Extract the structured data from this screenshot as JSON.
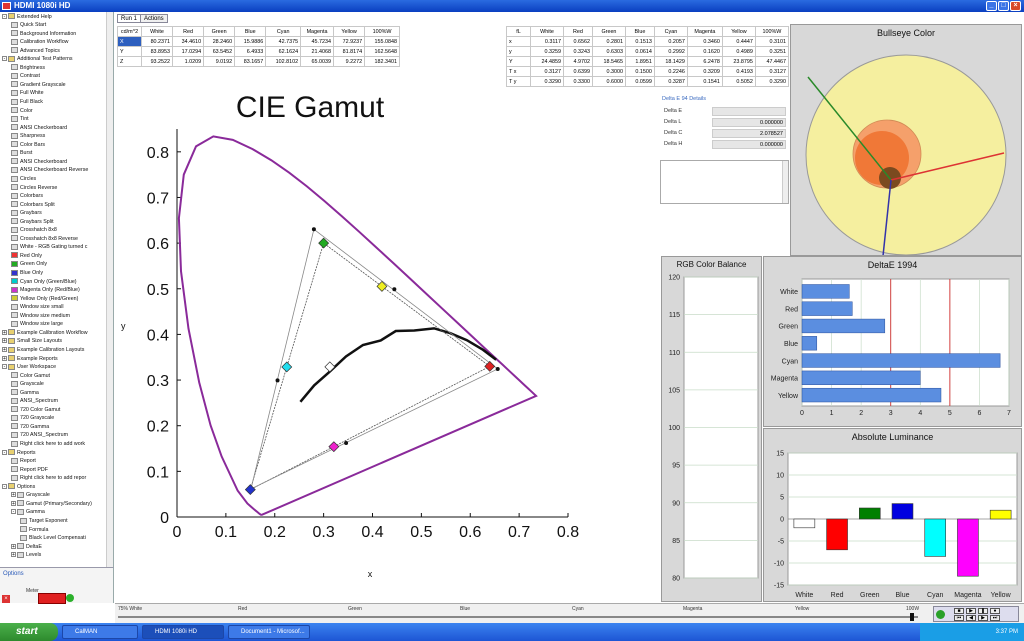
{
  "window": {
    "title": "HDMI 1080i HD"
  },
  "tabs": [
    "Run 1",
    "Actions"
  ],
  "sidebar": {
    "items": [
      {
        "label": "Extended Help",
        "level": 0,
        "pm": "-"
      },
      {
        "label": "Quick Start",
        "level": 1
      },
      {
        "label": "Background Information",
        "level": 1
      },
      {
        "label": "Calibration Workflow",
        "level": 1
      },
      {
        "label": "Advanced Topics",
        "level": 1
      },
      {
        "label": "Additional Test Patterns",
        "level": 0,
        "pm": "-"
      },
      {
        "label": "Brightness",
        "level": 1
      },
      {
        "label": "Contrast",
        "level": 1
      },
      {
        "label": "Gradient Grayscale",
        "level": 1
      },
      {
        "label": "Full White",
        "level": 1
      },
      {
        "label": "Full Black",
        "level": 1
      },
      {
        "label": "Color",
        "level": 1
      },
      {
        "label": "Tint",
        "level": 1
      },
      {
        "label": "ANSI Checkerboard",
        "level": 1
      },
      {
        "label": "Sharpness",
        "level": 1
      },
      {
        "label": "Color Bars",
        "level": 1
      },
      {
        "label": "Burst",
        "level": 1
      },
      {
        "label": "ANSI Checkerboard",
        "level": 1
      },
      {
        "label": "ANSI Checkerboard Reverse",
        "level": 1
      },
      {
        "label": "Circles",
        "level": 1
      },
      {
        "label": "Circles Reverse",
        "level": 1
      },
      {
        "label": "Colorbars",
        "level": 1
      },
      {
        "label": "Colorbars Split",
        "level": 1
      },
      {
        "label": "Graybars",
        "level": 1
      },
      {
        "label": "Graybars Split",
        "level": 1
      },
      {
        "label": "Crosshatch 8x8",
        "level": 1
      },
      {
        "label": "Crosshatch 8x8 Reverse",
        "level": 1
      },
      {
        "label": "White - RGB Gating turned c",
        "level": 1
      },
      {
        "label": "Red Only",
        "level": 1
      },
      {
        "label": "Green Only",
        "level": 1
      },
      {
        "label": "Blue Only",
        "level": 1
      },
      {
        "label": "Cyan Only (Green/Blue)",
        "level": 1
      },
      {
        "label": "Magenta Only (Red/Blue)",
        "level": 1
      },
      {
        "label": "Yellow Only (Red/Green)",
        "level": 1
      },
      {
        "label": "Window size small",
        "level": 1
      },
      {
        "label": "Window size medium",
        "level": 1
      },
      {
        "label": "Window size large",
        "level": 1
      },
      {
        "label": "Example Calibration Workflow",
        "level": 0,
        "pm": "+"
      },
      {
        "label": "Small Size Layouts",
        "level": 0,
        "pm": "+"
      },
      {
        "label": "Example Calibration Layouts",
        "level": 0,
        "pm": "+"
      },
      {
        "label": "Example Reports",
        "level": 0,
        "pm": "+"
      },
      {
        "label": "User Workspace",
        "level": 0,
        "pm": "-"
      },
      {
        "label": "Color Gamut",
        "level": 1
      },
      {
        "label": "Grayscale",
        "level": 1
      },
      {
        "label": "Gamma",
        "level": 1
      },
      {
        "label": "ANSI_Spectrum",
        "level": 1
      },
      {
        "label": "720 Color Gamut",
        "level": 1
      },
      {
        "label": "720 Grayscale",
        "level": 1
      },
      {
        "label": "720 Gamma",
        "level": 1
      },
      {
        "label": "720 ANSI_Spectrum",
        "level": 1
      },
      {
        "label": "Right click here to add work",
        "level": 1
      },
      {
        "label": "Reports",
        "level": 0,
        "pm": "-"
      },
      {
        "label": "Report",
        "level": 1
      },
      {
        "label": "Report PDF",
        "level": 1
      },
      {
        "label": "Right click here to add repor",
        "level": 1
      },
      {
        "label": "Options",
        "level": 0,
        "pm": "-"
      },
      {
        "label": "Grayscale",
        "level": 1,
        "pm": "+"
      },
      {
        "label": "Gamut (Primary/Secondary)",
        "level": 1,
        "pm": "+"
      },
      {
        "label": "Gamma",
        "level": 1,
        "pm": "-"
      },
      {
        "label": "Target Exponent",
        "level": 2
      },
      {
        "label": "Formula",
        "level": 2
      },
      {
        "label": "Black Level Compensati",
        "level": 2
      },
      {
        "label": "DeltaE",
        "level": 1,
        "pm": "+"
      },
      {
        "label": "Levels",
        "level": 1,
        "pm": "+"
      }
    ],
    "options_label": "Options",
    "meter_label": "Meter"
  },
  "table1": {
    "headers": [
      "cd/m^2",
      "White",
      "Red",
      "Green",
      "Blue",
      "Cyan",
      "Magenta",
      "Yellow",
      "100%W"
    ],
    "rows": [
      [
        "X",
        "80.2371",
        "34.4610",
        "28.2460",
        "15.9886",
        "42.7375",
        "45.7234",
        "72.9237",
        "155.0848"
      ],
      [
        "Y",
        "83.8953",
        "17.0294",
        "63.5452",
        "6.4933",
        "62.1624",
        "21.4068",
        "81.8174",
        "162.5648"
      ],
      [
        "Z",
        "93.2522",
        "1.0209",
        "9.0192",
        "83.1657",
        "102.8102",
        "65.0039",
        "9.2272",
        "182.3401"
      ]
    ]
  },
  "table2": {
    "headers": [
      "fL",
      "White",
      "Red",
      "Green",
      "Blue",
      "Cyan",
      "Magenta",
      "Yellow",
      "100%W"
    ],
    "rows": [
      [
        "x",
        "0.3117",
        "0.6562",
        "0.2801",
        "0.1513",
        "0.2057",
        "0.3460",
        "0.4447",
        "0.3101"
      ],
      [
        "y",
        "0.3259",
        "0.3243",
        "0.6303",
        "0.0614",
        "0.2992",
        "0.1620",
        "0.4989",
        "0.3251"
      ],
      [
        "Y",
        "24.4859",
        "4.9702",
        "18.5465",
        "1.8951",
        "18.1429",
        "6.2478",
        "23.8795",
        "47.4467"
      ],
      [
        "T x",
        "0.3127",
        "0.6399",
        "0.3000",
        "0.1500",
        "0.2246",
        "0.3209",
        "0.4193",
        "0.3127"
      ],
      [
        "T y",
        "0.3290",
        "0.3300",
        "0.6000",
        "0.0599",
        "0.3287",
        "0.1541",
        "0.5052",
        "0.3290"
      ]
    ]
  },
  "delta_details": {
    "title": "Delta E 94 Details",
    "rows": [
      {
        "label": "Delta E",
        "value": ""
      },
      {
        "label": "Delta L",
        "value": "0.000000"
      },
      {
        "label": "Delta C",
        "value": "2.078527"
      },
      {
        "label": "Delta H",
        "value": "0.000000"
      }
    ]
  },
  "status_bar": {
    "labels": [
      "75% White",
      "Red",
      "Green",
      "Blue",
      "Cyan",
      "Magenta",
      "Yellow",
      "100W"
    ]
  },
  "taskbar": {
    "start": "start",
    "tasks": [
      "CalMAN",
      "HDMI 1080i HD",
      "Document1 - Microsof..."
    ],
    "clock": "3:37 PM"
  },
  "chart_data": [
    {
      "type": "scatter",
      "title": "CIE Gamut",
      "xlabel": "x",
      "ylabel": "y",
      "xlim": [
        0,
        0.8
      ],
      "ylim": [
        0,
        0.85
      ],
      "xticks": [
        "0",
        "0.1",
        "0.2",
        "0.3",
        "0.4",
        "0.5",
        "0.6",
        "0.7",
        "0.8"
      ],
      "yticks": [
        "0",
        "0.1",
        "0.2",
        "0.3",
        "0.4",
        "0.5",
        "0.6",
        "0.7",
        "0.8"
      ],
      "spectral_locus": [
        [
          0.1741,
          0.005
        ],
        [
          0.1738,
          0.0049
        ],
        [
          0.1733,
          0.0048
        ],
        [
          0.1726,
          0.0048
        ],
        [
          0.1714,
          0.0051
        ],
        [
          0.1689,
          0.0069
        ],
        [
          0.1644,
          0.0109
        ],
        [
          0.1566,
          0.0177
        ],
        [
          0.144,
          0.0297
        ],
        [
          0.1241,
          0.0578
        ],
        [
          0.0913,
          0.1327
        ],
        [
          0.0687,
          0.2007
        ],
        [
          0.0454,
          0.295
        ],
        [
          0.0235,
          0.4127
        ],
        [
          0.0082,
          0.5384
        ],
        [
          0.0039,
          0.6548
        ],
        [
          0.0139,
          0.7502
        ],
        [
          0.0389,
          0.812
        ],
        [
          0.0743,
          0.8338
        ],
        [
          0.1142,
          0.8262
        ],
        [
          0.1547,
          0.8059
        ],
        [
          0.1929,
          0.7816
        ],
        [
          0.2296,
          0.7543
        ],
        [
          0.2658,
          0.7243
        ],
        [
          0.3016,
          0.6923
        ],
        [
          0.3373,
          0.6589
        ],
        [
          0.3731,
          0.6245
        ],
        [
          0.4087,
          0.5896
        ],
        [
          0.4441,
          0.5547
        ],
        [
          0.4788,
          0.5202
        ],
        [
          0.5125,
          0.4866
        ],
        [
          0.5448,
          0.4544
        ],
        [
          0.5752,
          0.4242
        ],
        [
          0.6029,
          0.3965
        ],
        [
          0.627,
          0.3725
        ],
        [
          0.6482,
          0.3514
        ],
        [
          0.6658,
          0.334
        ],
        [
          0.6801,
          0.3197
        ],
        [
          0.6915,
          0.3083
        ],
        [
          0.7006,
          0.2993
        ],
        [
          0.7079,
          0.292
        ],
        [
          0.714,
          0.2859
        ],
        [
          0.719,
          0.2809
        ],
        [
          0.723,
          0.277
        ],
        [
          0.726,
          0.274
        ],
        [
          0.7347,
          0.2653
        ]
      ],
      "planckian_locus": [
        [
          0.2525,
          0.2523
        ],
        [
          0.2806,
          0.2883
        ],
        [
          0.3101,
          0.3162
        ],
        [
          0.3457,
          0.3516
        ],
        [
          0.3805,
          0.3768
        ],
        [
          0.4169,
          0.3868
        ],
        [
          0.4476,
          0.4074
        ],
        [
          0.4855,
          0.4087
        ],
        [
          0.526,
          0.4133
        ],
        [
          0.5586,
          0.4029
        ],
        [
          0.5932,
          0.3873
        ],
        [
          0.6262,
          0.3662
        ],
        [
          0.653,
          0.3446
        ]
      ],
      "target": {
        "x": [
          0.64,
          0.3,
          0.15
        ],
        "y": [
          0.33,
          0.6,
          0.06
        ]
      },
      "measured": {
        "x": [
          0.6562,
          0.2801,
          0.1513
        ],
        "y": [
          0.3243,
          0.6303,
          0.0614
        ]
      },
      "markers": [
        {
          "name": "Red",
          "x": 0.6399,
          "y": 0.33,
          "color": "#dd2222"
        },
        {
          "name": "Green",
          "x": 0.3,
          "y": 0.6,
          "color": "#22aa22"
        },
        {
          "name": "Blue",
          "x": 0.15,
          "y": 0.06,
          "color": "#2233cc"
        },
        {
          "name": "Cyan",
          "x": 0.2246,
          "y": 0.3287,
          "color": "#22ddee"
        },
        {
          "name": "Magenta",
          "x": 0.3209,
          "y": 0.1541,
          "color": "#ee22cc"
        },
        {
          "name": "Yellow",
          "x": 0.4193,
          "y": 0.5052,
          "color": "#eeee22"
        },
        {
          "name": "White",
          "x": 0.3127,
          "y": 0.329,
          "color": "#ffffff"
        }
      ],
      "measured_points": [
        {
          "x": 0.6562,
          "y": 0.3243
        },
        {
          "x": 0.2801,
          "y": 0.6303
        },
        {
          "x": 0.1513,
          "y": 0.0614
        },
        {
          "x": 0.2057,
          "y": 0.2992
        },
        {
          "x": 0.346,
          "y": 0.162
        },
        {
          "x": 0.4447,
          "y": 0.4989
        },
        {
          "x": 0.3117,
          "y": 0.3259
        }
      ]
    },
    {
      "type": "bar",
      "title": "DeltaE 1994",
      "orientation": "horizontal",
      "categories": [
        "White",
        "Red",
        "Green",
        "Blue",
        "Cyan",
        "Magenta",
        "Yellow"
      ],
      "values": [
        1.6,
        1.7,
        2.8,
        0.5,
        6.7,
        4.0,
        4.7
      ],
      "xlim": [
        0,
        7
      ],
      "xticks": [
        "0",
        "1",
        "2",
        "3",
        "4",
        "5",
        "6",
        "7"
      ],
      "reference_lines": [
        3,
        5
      ],
      "bar_color": "#5b8ee0"
    },
    {
      "type": "bar",
      "title": "Absolute Luminance",
      "categories": [
        "White",
        "Red",
        "Green",
        "Blue",
        "Cyan",
        "Magenta",
        "Yellow"
      ],
      "values": [
        -2,
        -7,
        2.5,
        3.5,
        -8.5,
        -13,
        2
      ],
      "colors": [
        "#ffffff",
        "#ff0000",
        "#008000",
        "#0000e0",
        "#00ffff",
        "#ff00ff",
        "#ffff00"
      ],
      "ylim": [
        -15,
        15
      ],
      "yticks": [
        "15",
        "10",
        "5",
        "0",
        "-5",
        "-10",
        "-15"
      ]
    },
    {
      "type": "bar",
      "title": "RGB Color Balance",
      "categories": [],
      "values": [],
      "ylim": [
        80,
        120
      ],
      "yticks": [
        "120",
        "115",
        "110",
        "105",
        "100",
        "95",
        "90",
        "85",
        "80"
      ]
    },
    {
      "type": "scatter",
      "title": "Bullseye Color",
      "rings": [
        {
          "color": "#f5ef9f"
        },
        {
          "color": "#f5a06b"
        },
        {
          "color": "#f07837"
        },
        {
          "color": "#7b4a1f"
        }
      ],
      "vector_colors": [
        "#2a8a2a",
        "#dd3333",
        "#3333aa"
      ]
    }
  ]
}
